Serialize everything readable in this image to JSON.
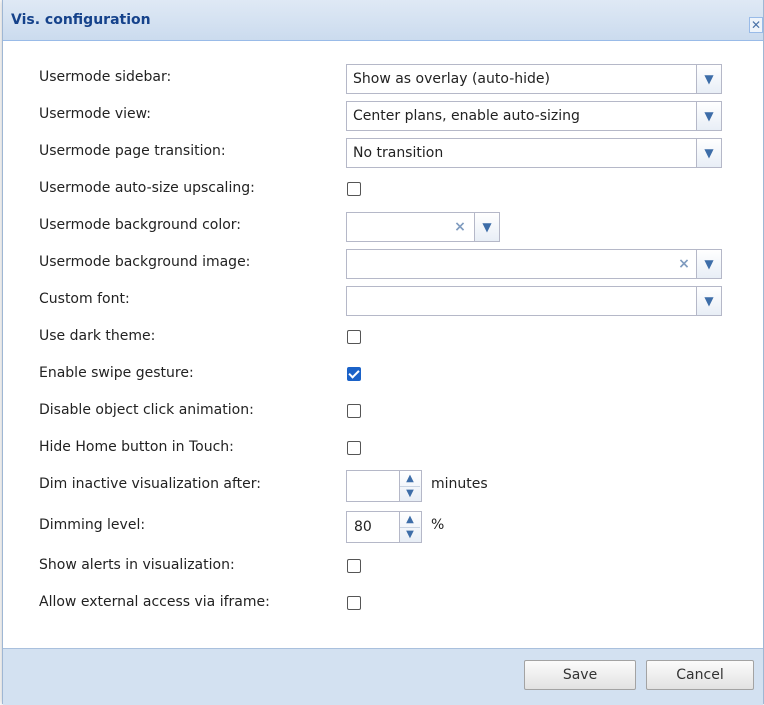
{
  "dialog": {
    "title": "Vis. configuration",
    "close_glyph": "✕"
  },
  "fields": {
    "sidebar": {
      "label": "Usermode sidebar:",
      "value": "Show as overlay (auto-hide)"
    },
    "view": {
      "label": "Usermode view:",
      "value": "Center plans, enable auto-sizing"
    },
    "transition": {
      "label": "Usermode page transition:",
      "value": "No transition"
    },
    "upscaling": {
      "label": "Usermode auto-size upscaling:",
      "checked": false
    },
    "bgcolor": {
      "label": "Usermode background color:",
      "value": ""
    },
    "bgimage": {
      "label": "Usermode background image:",
      "value": ""
    },
    "font": {
      "label": "Custom font:",
      "value": ""
    },
    "dark": {
      "label": "Use dark theme:",
      "checked": false
    },
    "swipe": {
      "label": "Enable swipe gesture:",
      "checked": true
    },
    "clickanim": {
      "label": "Disable object click animation:",
      "checked": false
    },
    "homebtn": {
      "label": "Hide Home button in Touch:",
      "checked": false
    },
    "dim": {
      "label": "Dim inactive visualization after:",
      "value": "",
      "unit": "minutes"
    },
    "dimlevel": {
      "label": "Dimming level:",
      "value": "80",
      "unit": "%"
    },
    "alerts": {
      "label": "Show alerts in visualization:",
      "checked": false
    },
    "iframe": {
      "label": "Allow external access via iframe:",
      "checked": false
    }
  },
  "glyphs": {
    "dropdown": "▼",
    "clear": "×",
    "up": "▲",
    "down": "▼"
  },
  "icons": [
    "close-icon",
    "chevron-down-icon",
    "clear-icon",
    "spinner-up-icon",
    "spinner-down-icon",
    "checkmark-icon"
  ],
  "buttons": {
    "save": "Save",
    "cancel": "Cancel"
  },
  "colors": {
    "accent": "#1b62c8",
    "title": "#15428b",
    "footer": "#d3e1f1"
  }
}
